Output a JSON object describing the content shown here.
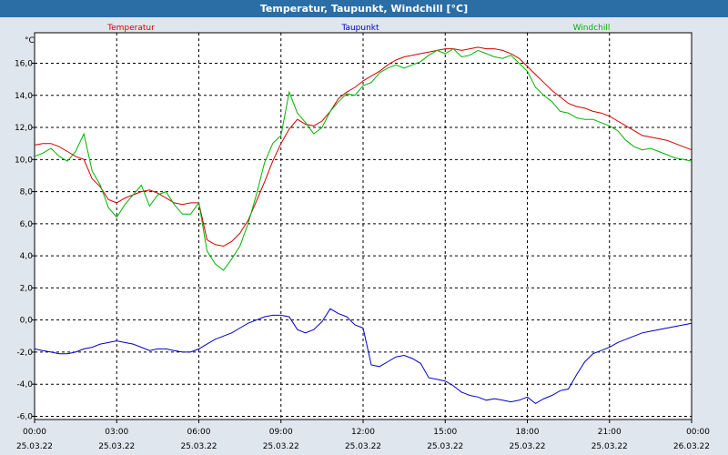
{
  "window": {
    "title": "Temperatur, Taupunkt, Windchill [°C]"
  },
  "chart_data": {
    "type": "line",
    "title": "Temperatur, Taupunkt, Windchill [°C]",
    "ylabel": "°C",
    "xlabel": "",
    "ylim": [
      -6.2,
      17.9
    ],
    "xlim": [
      0,
      24
    ],
    "grid": true,
    "legend_placement": "top",
    "yticks": [
      {
        "v": 16,
        "label": "16,0"
      },
      {
        "v": 14,
        "label": "14,0"
      },
      {
        "v": 12,
        "label": "12,0"
      },
      {
        "v": 10,
        "label": "10,0"
      },
      {
        "v": 8,
        "label": "8,0"
      },
      {
        "v": 6,
        "label": "6,0"
      },
      {
        "v": 4,
        "label": "4,0"
      },
      {
        "v": 2,
        "label": "2,0"
      },
      {
        "v": 0,
        "label": "0,0"
      },
      {
        "v": -2,
        "label": "-2,0"
      },
      {
        "v": -4,
        "label": "-4,0"
      },
      {
        "v": -6,
        "label": "-6,0"
      }
    ],
    "xticks": [
      {
        "h": 0,
        "time": "00:00",
        "date": "25.03.22"
      },
      {
        "h": 3,
        "time": "03:00",
        "date": "25.03.22"
      },
      {
        "h": 6,
        "time": "06:00",
        "date": "25.03.22"
      },
      {
        "h": 9,
        "time": "09:00",
        "date": "25.03.22"
      },
      {
        "h": 12,
        "time": "12:00",
        "date": "25.03.22"
      },
      {
        "h": 15,
        "time": "15:00",
        "date": "25.03.22"
      },
      {
        "h": 18,
        "time": "18:00",
        "date": "25.03.22"
      },
      {
        "h": 21,
        "time": "21:00",
        "date": "25.03.22"
      },
      {
        "h": 24,
        "time": "00:00",
        "date": "26.03.22"
      }
    ],
    "series": [
      {
        "name": "Temperatur",
        "color": "#d40000",
        "x": [
          0,
          0.3,
          0.6,
          0.9,
          1.2,
          1.5,
          1.8,
          2.1,
          2.4,
          2.7,
          3.0,
          3.3,
          3.6,
          3.9,
          4.2,
          4.5,
          4.8,
          5.1,
          5.4,
          5.7,
          6.0,
          6.3,
          6.6,
          6.9,
          7.2,
          7.5,
          7.8,
          8.1,
          8.4,
          8.7,
          9.0,
          9.3,
          9.6,
          9.9,
          10.2,
          10.5,
          10.8,
          11.1,
          11.4,
          11.7,
          12.0,
          12.3,
          12.6,
          12.9,
          13.2,
          13.5,
          13.8,
          14.1,
          14.4,
          14.7,
          15.0,
          15.3,
          15.6,
          15.9,
          16.2,
          16.5,
          16.8,
          17.1,
          17.4,
          17.7,
          18.0,
          18.3,
          18.6,
          18.9,
          19.2,
          19.5,
          19.8,
          20.1,
          20.4,
          20.7,
          21.0,
          21.3,
          21.6,
          21.9,
          22.2,
          22.5,
          22.8,
          23.1,
          23.4,
          23.7,
          24.0
        ],
        "values": [
          10.9,
          11.0,
          11.0,
          10.8,
          10.5,
          10.2,
          10.0,
          8.8,
          8.3,
          7.5,
          7.3,
          7.6,
          7.8,
          8.0,
          8.1,
          7.9,
          7.6,
          7.3,
          7.2,
          7.3,
          7.3,
          5.0,
          4.7,
          4.6,
          4.9,
          5.4,
          6.2,
          7.4,
          8.6,
          9.9,
          11.0,
          11.9,
          12.5,
          12.2,
          12.1,
          12.4,
          13.0,
          13.8,
          14.2,
          14.5,
          14.9,
          15.2,
          15.5,
          15.9,
          16.2,
          16.4,
          16.5,
          16.6,
          16.7,
          16.8,
          16.9,
          16.9,
          16.8,
          16.9,
          17.0,
          16.9,
          16.9,
          16.8,
          16.6,
          16.3,
          15.8,
          15.3,
          14.8,
          14.3,
          13.9,
          13.5,
          13.3,
          13.2,
          13.0,
          12.9,
          12.7,
          12.4,
          12.1,
          11.8,
          11.5,
          11.4,
          11.3,
          11.2,
          11.0,
          10.8,
          10.6
        ]
      },
      {
        "name": "Taupunkt",
        "color": "#0000c8",
        "x": [
          0,
          0.3,
          0.6,
          0.9,
          1.2,
          1.5,
          1.8,
          2.1,
          2.4,
          2.7,
          3.0,
          3.3,
          3.6,
          3.9,
          4.2,
          4.5,
          4.8,
          5.1,
          5.4,
          5.7,
          6.0,
          6.3,
          6.6,
          6.9,
          7.2,
          7.5,
          7.8,
          8.1,
          8.4,
          8.7,
          9.0,
          9.3,
          9.6,
          9.9,
          10.2,
          10.5,
          10.8,
          11.1,
          11.4,
          11.7,
          12.0,
          12.3,
          12.6,
          12.9,
          13.2,
          13.5,
          13.8,
          14.1,
          14.4,
          14.7,
          15.0,
          15.3,
          15.6,
          15.9,
          16.2,
          16.5,
          16.8,
          17.1,
          17.4,
          17.7,
          18.0,
          18.3,
          18.6,
          18.9,
          19.2,
          19.5,
          19.8,
          20.1,
          20.4,
          20.7,
          21.0,
          21.3,
          21.6,
          21.9,
          22.2,
          22.5,
          22.8,
          23.1,
          23.4,
          23.7,
          24.0
        ],
        "values": [
          -1.8,
          -1.9,
          -2.0,
          -2.1,
          -2.1,
          -2.0,
          -1.8,
          -1.7,
          -1.5,
          -1.4,
          -1.3,
          -1.4,
          -1.5,
          -1.7,
          -1.9,
          -1.8,
          -1.8,
          -1.9,
          -2.0,
          -2.0,
          -1.8,
          -1.5,
          -1.2,
          -1.0,
          -0.8,
          -0.5,
          -0.2,
          0.0,
          0.2,
          0.3,
          0.3,
          0.2,
          -0.6,
          -0.8,
          -0.6,
          -0.1,
          0.7,
          0.4,
          0.2,
          -0.3,
          -0.5,
          -2.8,
          -2.9,
          -2.6,
          -2.3,
          -2.2,
          -2.4,
          -2.7,
          -3.6,
          -3.7,
          -3.8,
          -4.1,
          -4.5,
          -4.7,
          -4.8,
          -5.0,
          -4.9,
          -5.0,
          -5.1,
          -5.0,
          -4.8,
          -5.2,
          -4.9,
          -4.7,
          -4.4,
          -4.3,
          -3.4,
          -2.6,
          -2.1,
          -1.9,
          -1.7,
          -1.4,
          -1.2,
          -1.0,
          -0.8,
          -0.7,
          -0.6,
          -0.5,
          -0.4,
          -0.3,
          -0.2
        ]
      },
      {
        "name": "Windchill",
        "color": "#00b400",
        "x": [
          0,
          0.3,
          0.6,
          0.9,
          1.2,
          1.5,
          1.8,
          2.1,
          2.4,
          2.7,
          3.0,
          3.3,
          3.6,
          3.9,
          4.2,
          4.5,
          4.8,
          5.1,
          5.4,
          5.7,
          6.0,
          6.3,
          6.6,
          6.9,
          7.2,
          7.5,
          7.8,
          8.1,
          8.4,
          8.7,
          9.0,
          9.3,
          9.6,
          9.9,
          10.2,
          10.5,
          10.8,
          11.1,
          11.4,
          11.7,
          12.0,
          12.3,
          12.6,
          12.9,
          13.2,
          13.5,
          13.8,
          14.1,
          14.4,
          14.7,
          15.0,
          15.3,
          15.6,
          15.9,
          16.2,
          16.5,
          16.8,
          17.1,
          17.4,
          17.7,
          18.0,
          18.3,
          18.6,
          18.9,
          19.2,
          19.5,
          19.8,
          20.1,
          20.4,
          20.7,
          21.0,
          21.3,
          21.6,
          21.9,
          22.2,
          22.5,
          22.8,
          23.1,
          23.4,
          23.7,
          24.0
        ],
        "values": [
          10.2,
          10.4,
          10.7,
          10.2,
          9.9,
          10.5,
          11.6,
          9.3,
          8.4,
          7.0,
          6.4,
          7.2,
          7.8,
          8.4,
          7.1,
          7.8,
          8.0,
          7.2,
          6.6,
          6.6,
          7.3,
          4.3,
          3.5,
          3.1,
          3.8,
          4.6,
          6.0,
          7.8,
          9.8,
          11.0,
          11.5,
          14.2,
          12.9,
          12.3,
          11.6,
          12.0,
          13.0,
          13.6,
          14.1,
          14.0,
          14.6,
          14.8,
          15.4,
          15.7,
          15.9,
          15.7,
          15.9,
          16.1,
          16.5,
          16.8,
          16.6,
          16.9,
          16.4,
          16.5,
          16.8,
          16.6,
          16.4,
          16.3,
          16.5,
          16.0,
          15.5,
          14.5,
          14.0,
          13.6,
          13.0,
          12.9,
          12.6,
          12.5,
          12.5,
          12.3,
          12.1,
          11.8,
          11.2,
          10.8,
          10.6,
          10.7,
          10.5,
          10.3,
          10.1,
          10.0,
          9.9
        ]
      }
    ]
  }
}
